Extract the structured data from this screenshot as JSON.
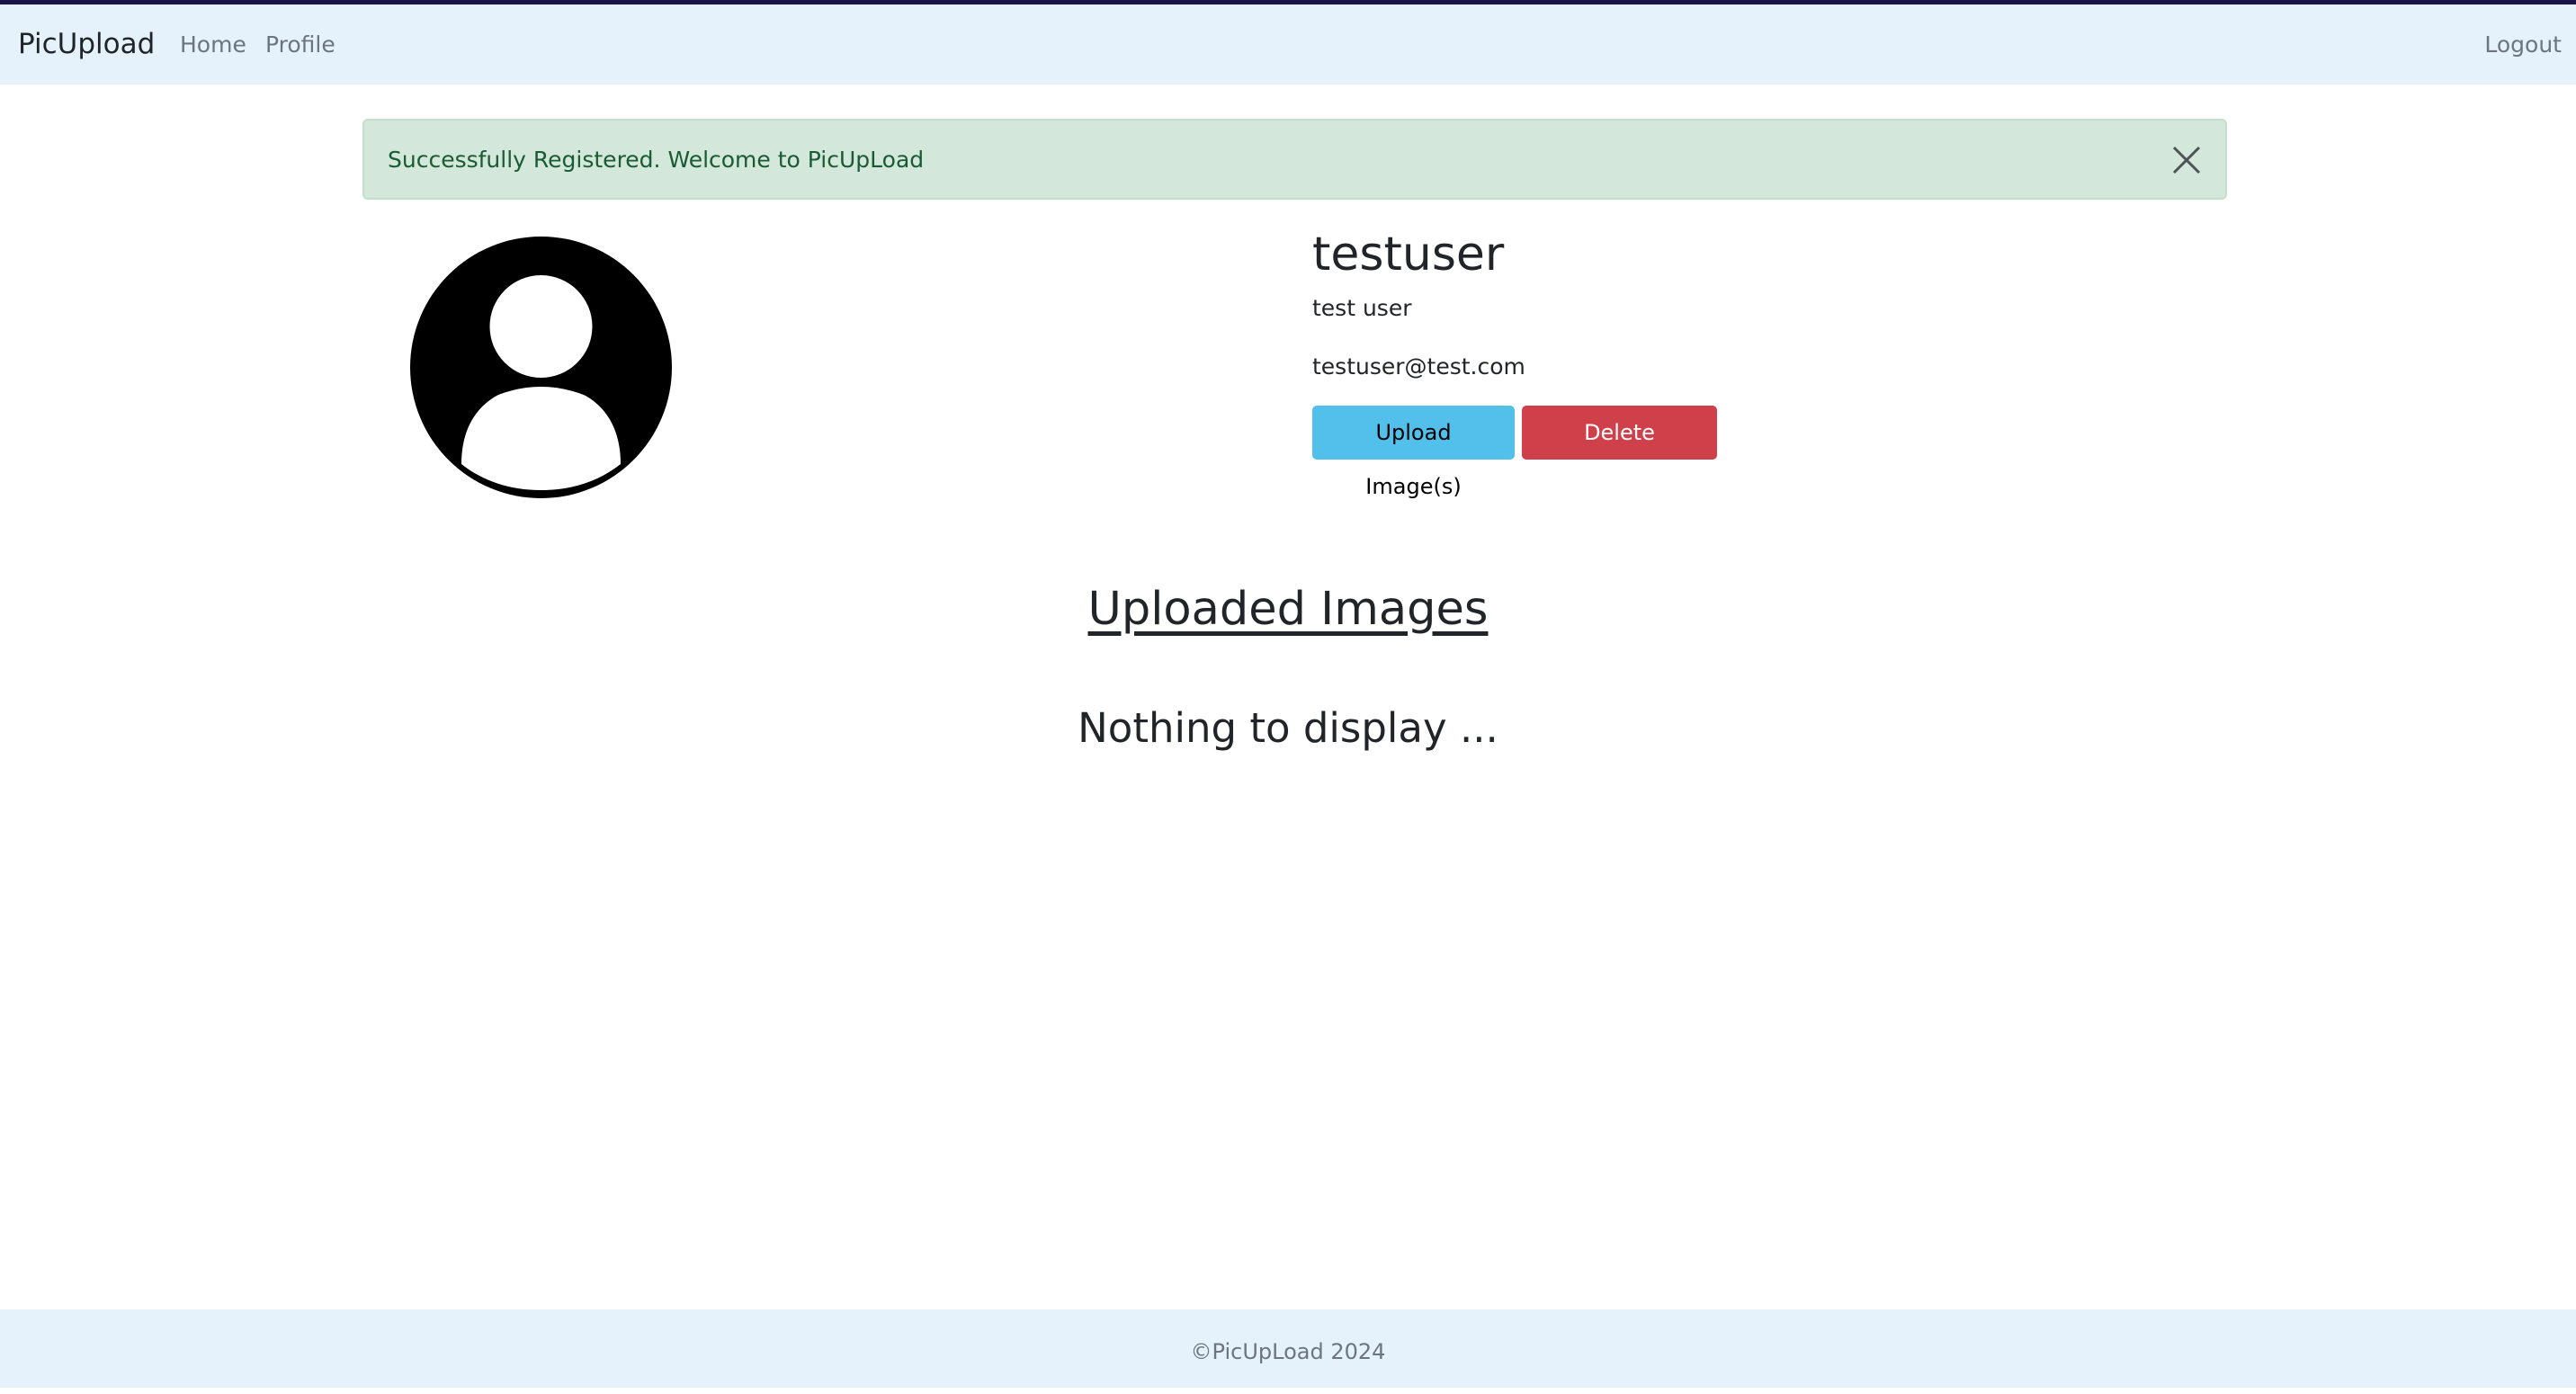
{
  "navbar": {
    "brand": "PicUpload",
    "links": [
      {
        "label": "Home"
      },
      {
        "label": "Profile"
      }
    ],
    "logout_label": "Logout"
  },
  "alert": {
    "message": "Successfully Registered. Welcome to PicUpLoad",
    "close_icon": "close-icon"
  },
  "profile": {
    "avatar_icon": "user-avatar-icon",
    "username": "testuser",
    "full_name": "test user",
    "email": "testuser@test.com",
    "upload_label": "Upload Image(s)",
    "delete_label": "Delete Image(s)"
  },
  "gallery": {
    "title": "Uploaded Images",
    "empty_message": "Nothing to display ..."
  },
  "footer": {
    "text": "©PicUpLoad 2024"
  },
  "colors": {
    "navbar_bg": "#e6f2fb",
    "alert_bg": "#d4e7db",
    "upload_button": "#52c0ea",
    "delete_button": "#d0404b"
  }
}
